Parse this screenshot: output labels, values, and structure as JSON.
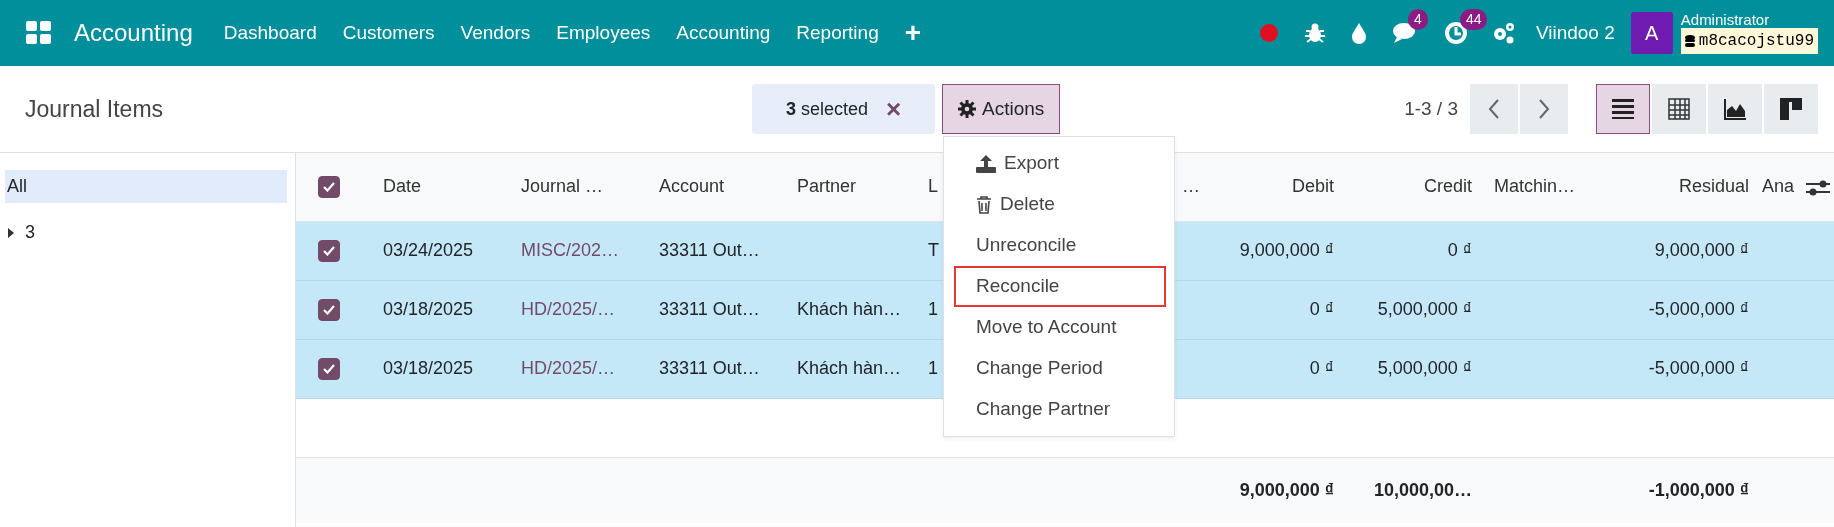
{
  "navbar": {
    "app_name": "Accounting",
    "menu": [
      "Dashboard",
      "Customers",
      "Vendors",
      "Employees",
      "Accounting",
      "Reporting",
      "+"
    ],
    "systray": [
      {
        "kind": "record"
      },
      {
        "kind": "bug"
      },
      {
        "kind": "drop"
      },
      {
        "kind": "chat",
        "badge": "4"
      },
      {
        "kind": "clock",
        "badge": "44"
      },
      {
        "kind": "gears"
      }
    ],
    "company": "Viindoo 2",
    "avatar_letter": "A",
    "user_name": "Administrator",
    "database": "m8cacojstu99"
  },
  "control_panel": {
    "title": "Journal Items",
    "selection": {
      "count": "3",
      "label": "selected",
      "clear": "×"
    },
    "actions_label": "Actions",
    "pager": "1-3 / 3",
    "views": [
      {
        "kind": "list",
        "selected": true
      },
      {
        "kind": "pivot",
        "selected": false
      },
      {
        "kind": "graph",
        "selected": false
      },
      {
        "kind": "kanban",
        "selected": false
      }
    ]
  },
  "actions_menu": {
    "open": true,
    "items": [
      {
        "label": "Export",
        "kind": "export",
        "highlighted": false
      },
      {
        "label": "Delete",
        "kind": "delete",
        "highlighted": false
      },
      {
        "label": "Unreconcile",
        "kind": "plain",
        "highlighted": false
      },
      {
        "label": "Reconcile",
        "kind": "plain",
        "highlighted": true
      },
      {
        "label": "Move to Account",
        "kind": "plain",
        "highlighted": false
      },
      {
        "label": "Change Period",
        "kind": "plain",
        "highlighted": false
      },
      {
        "label": "Change Partner",
        "kind": "plain",
        "highlighted": false
      }
    ]
  },
  "sidebar": {
    "items": [
      {
        "label": "All",
        "selected": true,
        "kind": "plain"
      },
      {
        "label": "3",
        "selected": false,
        "kind": "group",
        "expanded": false
      }
    ]
  },
  "table": {
    "all_checked": true,
    "columns": [
      {
        "label": "Date",
        "kind": "text"
      },
      {
        "label": "Journal …",
        "kind": "link"
      },
      {
        "label": "Account",
        "kind": "text"
      },
      {
        "label": "Partner",
        "kind": "text"
      },
      {
        "label": "L",
        "kind": "text"
      },
      {
        "label": "…",
        "kind": "number"
      },
      {
        "label": "Debit",
        "kind": "number",
        "total": "9,000,000 ₫"
      },
      {
        "label": "Credit",
        "kind": "number",
        "total": "10,000,00…"
      },
      {
        "label": "Matchin…",
        "kind": "text"
      },
      {
        "label": "Residual",
        "kind": "number",
        "total": "-1,000,000 ₫"
      },
      {
        "label": "Ana",
        "kind": "text"
      }
    ],
    "rows": [
      {
        "selected": true,
        "cells": [
          "03/24/2025",
          "MISC/202…",
          "33311 Out…",
          null,
          "T",
          null,
          "9,000,000 ₫",
          "0 ₫",
          null,
          "9,000,000 ₫",
          null
        ]
      },
      {
        "selected": true,
        "cells": [
          "03/18/2025",
          "HD/2025/…",
          "33311 Out…",
          "Khách hàn…",
          "1",
          null,
          "0 ₫",
          "5,000,000 ₫",
          null,
          "-5,000,000 ₫",
          null
        ]
      },
      {
        "selected": true,
        "cells": [
          "03/18/2025",
          "HD/2025/…",
          "33311 Out…",
          "Khách hàn…",
          "1",
          null,
          "0 ₫",
          "5,000,000 ₫",
          null,
          "-5,000,000 ₫",
          null
        ]
      }
    ]
  }
}
